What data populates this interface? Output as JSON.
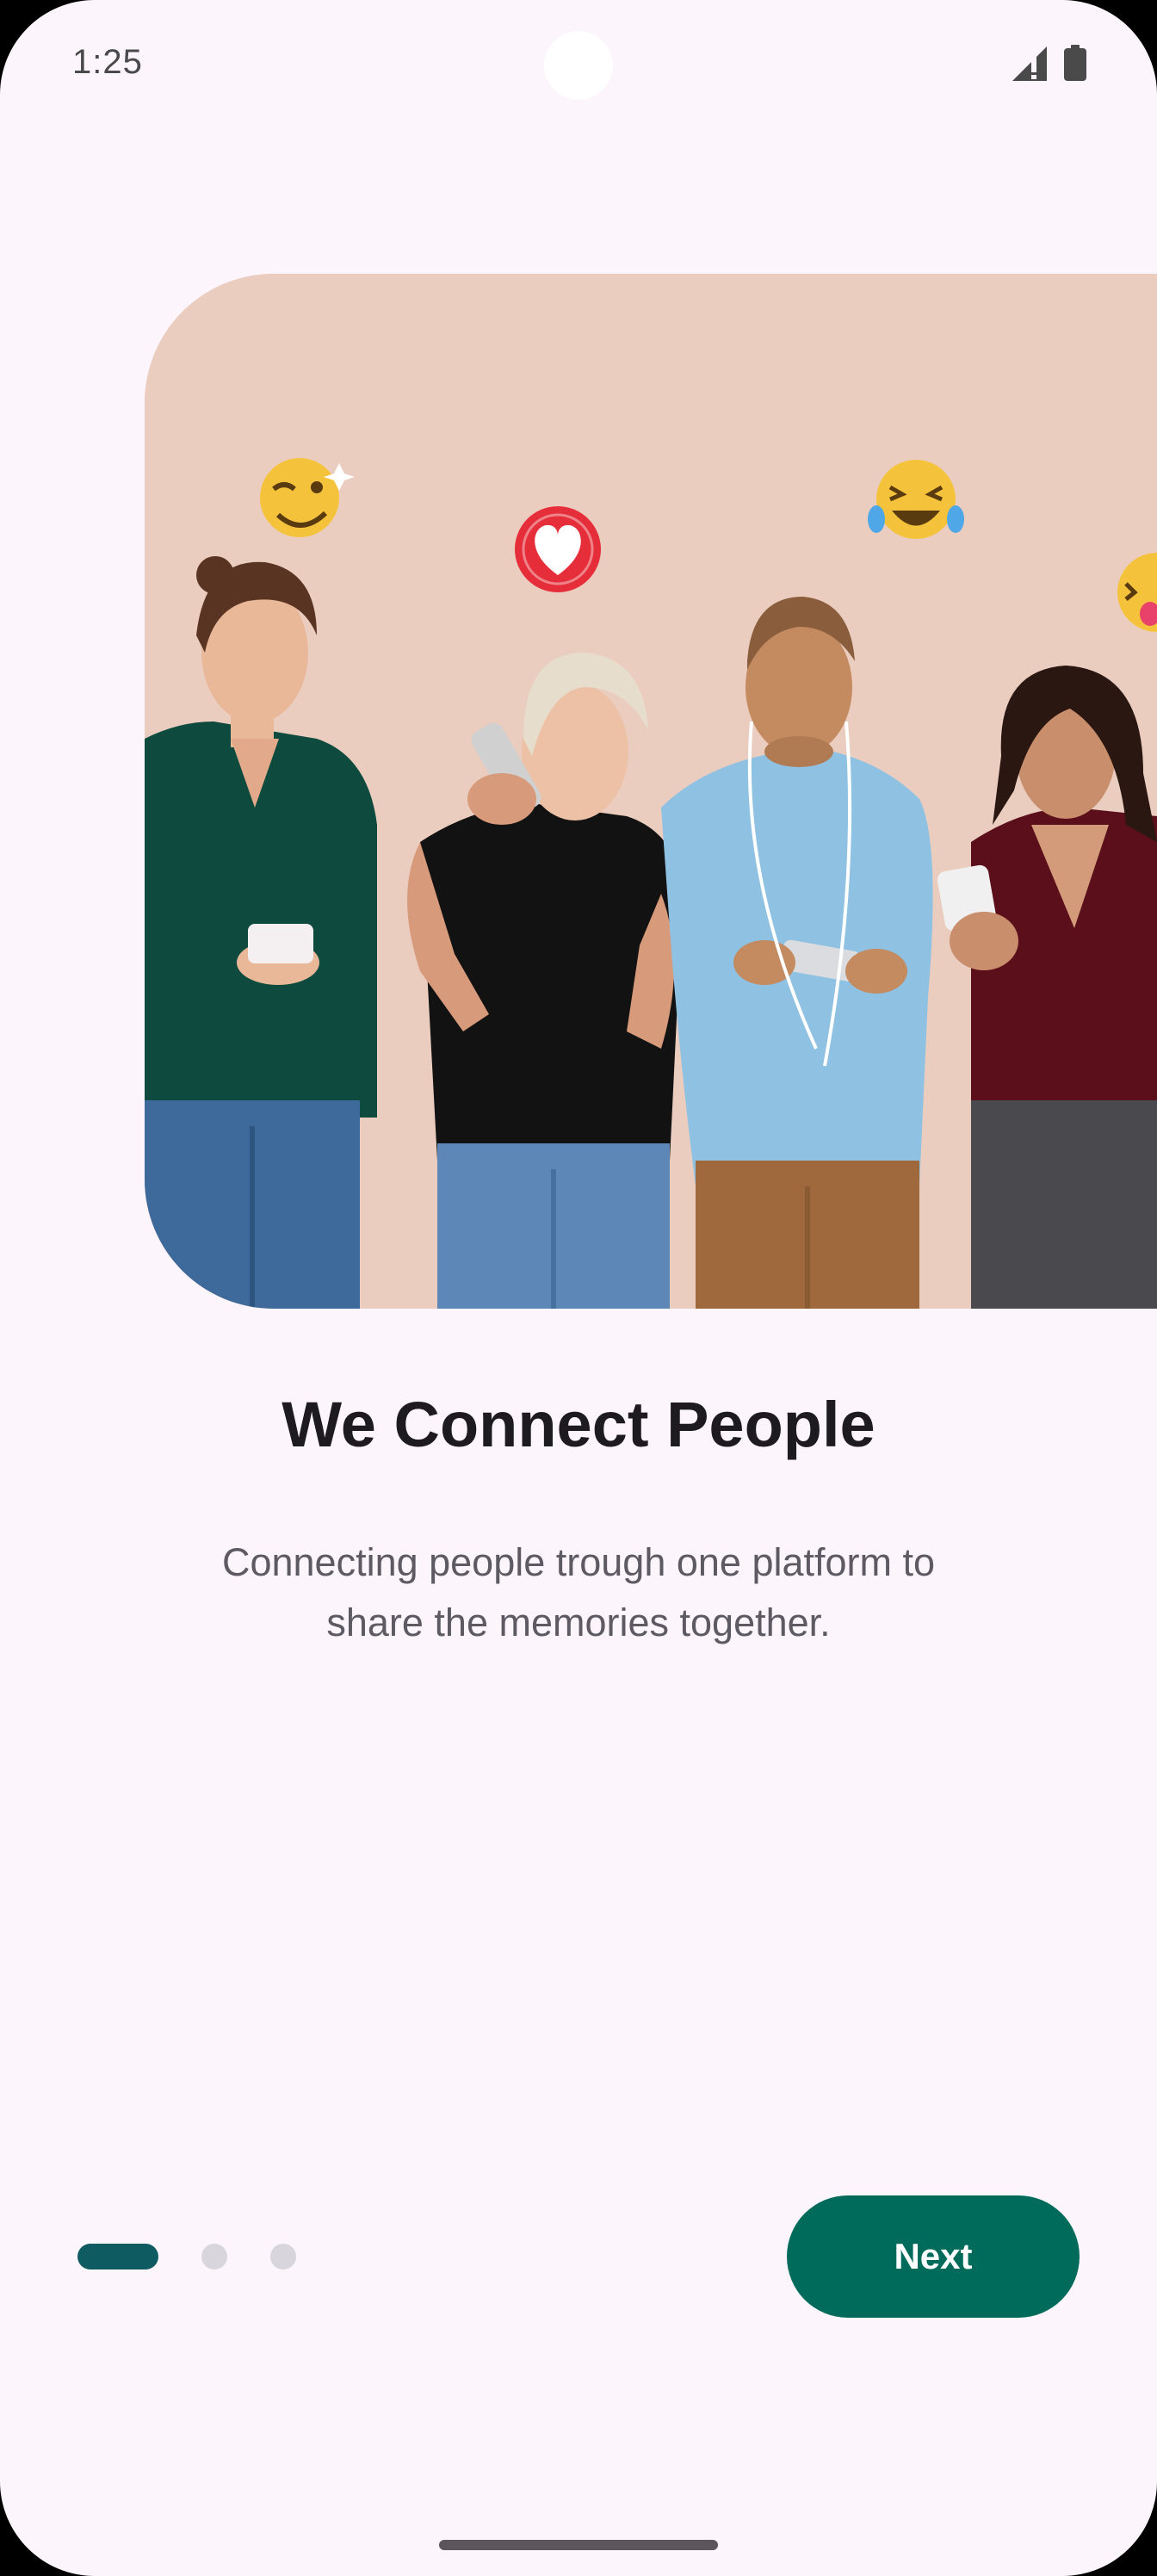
{
  "status_bar": {
    "time": "1:25",
    "icons": [
      "signal-icon",
      "battery-icon"
    ]
  },
  "hero": {
    "image": "people-with-phones-and-emoji-icons",
    "emojis": [
      "wink-emoji-icon",
      "heart-icon",
      "laughing-emoji-icon",
      "tongue-emoji-icon"
    ]
  },
  "onboarding": {
    "title": "We Connect People",
    "subtitle": "Connecting people trough one platform to share the memories together."
  },
  "pager": {
    "total_pages": 3,
    "current_page": 1
  },
  "actions": {
    "next_label": "Next"
  },
  "colors": {
    "background": "#FDF5FC",
    "primary": "#006B5B",
    "indicator_active": "#0F5B62",
    "indicator_inactive": "#D9D5DC",
    "title_text": "#1D1B20",
    "body_text": "#5E5A63"
  }
}
